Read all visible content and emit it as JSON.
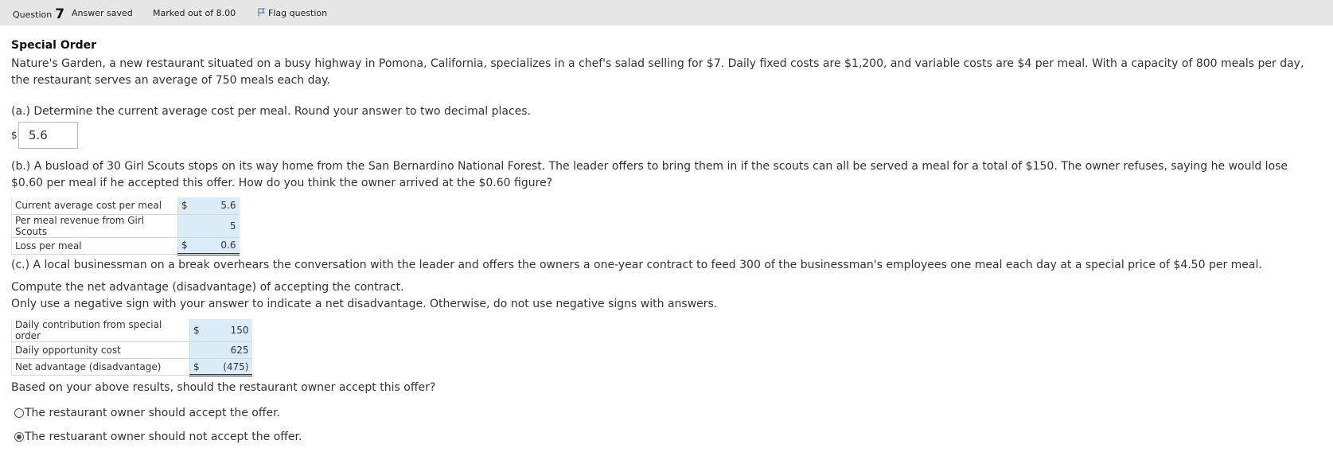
{
  "header": {
    "question_word": "Question",
    "question_number": "7",
    "status": "Answer saved",
    "marks": "Marked out of 8.00",
    "flag_label": "Flag question"
  },
  "question": {
    "title": "Special Order",
    "intro": "Nature's Garden, a new restaurant situated on a busy highway in Pomona, California, specializes in a chef's salad selling for $7. Daily fixed costs are $1,200, and variable costs are $4 per meal. With a capacity of 800 meals per day, the restaurant serves an average of 750 meals each day."
  },
  "part_a": {
    "prompt": "(a.) Determine the current average cost per meal. Round your answer to two decimal places.",
    "currency": "$",
    "answer": "5.6"
  },
  "part_b": {
    "prompt": "(b.) A busload of 30 Girl Scouts stops on its way home from the San Bernardino National Forest. The leader offers to bring them in if the scouts can all be served a meal for a total of $150. The owner refuses, saying he would lose $0.60 per meal if he accepted this offer. How do you think the owner arrived at the $0.60 figure?",
    "rows": [
      {
        "label": "Current average cost per meal",
        "currency": "$",
        "value": "5.6"
      },
      {
        "label": "Per meal revenue from Girl Scouts",
        "currency": "",
        "value": "5"
      },
      {
        "label": "Loss per meal",
        "currency": "$",
        "value": "0.6"
      }
    ]
  },
  "part_c": {
    "prompt": "(c.) A local businessman on a break overhears the conversation with the leader and offers the owners a one-year contract to feed 300 of the businessman's employees one meal each day at a special price of $4.50 per meal.",
    "instruction1": "Compute the net advantage (disadvantage) of accepting the contract.",
    "instruction2": "Only use a negative sign with your answer to indicate a net disadvantage. Otherwise, do not use negative signs with answers.",
    "rows": [
      {
        "label": "Daily contribution from special order",
        "currency": "$",
        "value": "150"
      },
      {
        "label": "Daily opportunity cost",
        "currency": "",
        "value": "625"
      },
      {
        "label": "Net advantage (disadvantage)",
        "currency": "$",
        "value": "(475)"
      }
    ],
    "decision_prompt": "Based on your above results, should the restaurant owner accept this offer?",
    "options": [
      {
        "label": "The restaurant owner should accept the offer.",
        "selected": false
      },
      {
        "label": "The restuarant owner should not accept the offer.",
        "selected": true
      }
    ]
  }
}
